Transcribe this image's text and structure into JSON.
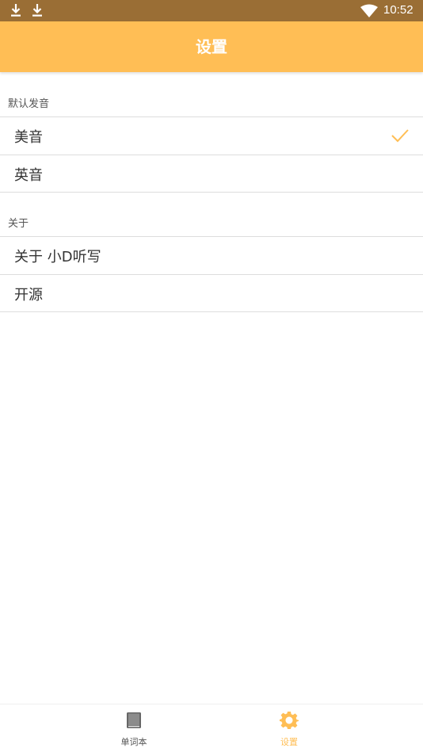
{
  "status_bar": {
    "time": "10:52",
    "icons": [
      "download-icon",
      "download-icon",
      "wifi-icon"
    ]
  },
  "app_bar": {
    "title": "设置",
    "color": "#ffbe55"
  },
  "sections": [
    {
      "header": "默认发音",
      "items": [
        {
          "label": "美音",
          "selected": true
        },
        {
          "label": "英音",
          "selected": false
        }
      ]
    },
    {
      "header": "关于",
      "items": [
        {
          "label": "关于 小D听写"
        },
        {
          "label": "开源"
        }
      ]
    }
  ],
  "bottom_nav": {
    "items": [
      {
        "label": "单词本",
        "icon": "book-icon",
        "active": false
      },
      {
        "label": "设置",
        "icon": "gear-icon",
        "active": true
      }
    ],
    "active_color": "#ffbe55",
    "inactive_color": "#555555"
  }
}
